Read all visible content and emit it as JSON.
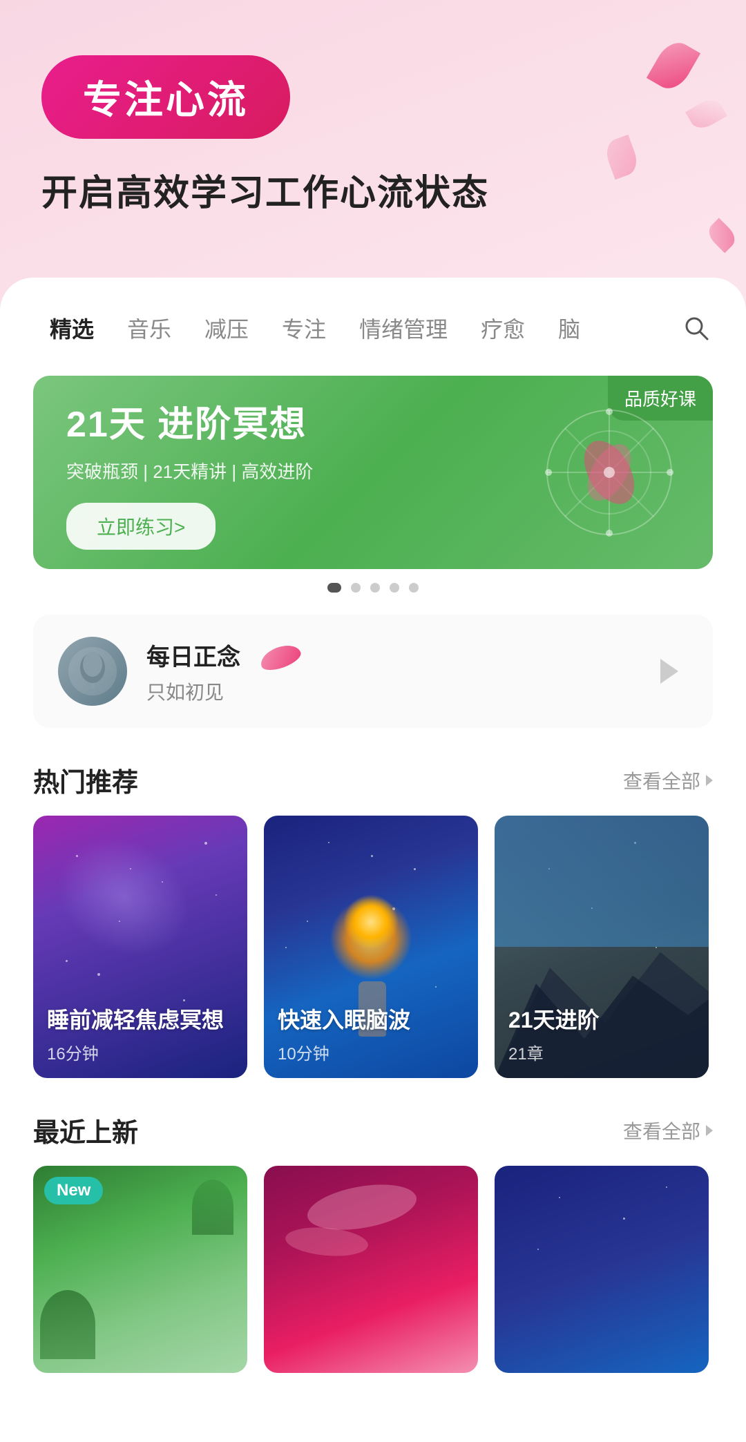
{
  "hero": {
    "badge_text": "专注心流",
    "subtitle": "开启高效学习工作心流状态"
  },
  "tabs": {
    "items": [
      {
        "label": "精选",
        "active": true
      },
      {
        "label": "音乐",
        "active": false
      },
      {
        "label": "减压",
        "active": false
      },
      {
        "label": "专注",
        "active": false
      },
      {
        "label": "情绪管理",
        "active": false
      },
      {
        "label": "疗愈",
        "active": false
      },
      {
        "label": "脑...",
        "active": false
      }
    ],
    "search_icon": "search-icon"
  },
  "banner": {
    "quality_tag": "品质好课",
    "title": "21天 进阶冥想",
    "desc": "突破瓶颈 | 21天精讲 | 高效进阶",
    "btn_text": "立即练习>",
    "dots_count": 5,
    "active_dot": 0
  },
  "daily": {
    "title": "每日正念",
    "subtitle": "只如初见",
    "play_icon": "play-icon"
  },
  "hot_section": {
    "title": "热门推荐",
    "more_text": "查看全部",
    "cards": [
      {
        "name": "睡前减轻焦虑冥想",
        "meta": "16分钟",
        "theme": "galaxy-purple"
      },
      {
        "name": "快速入眠脑波",
        "meta": "10分钟",
        "theme": "galaxy-blue"
      },
      {
        "name": "21天进阶...",
        "meta": "21章",
        "theme": "mountain-blue"
      }
    ]
  },
  "new_section": {
    "title": "最近上新",
    "more_text": "查看全部",
    "cards": [
      {
        "has_new_badge": true,
        "new_badge_text": "New",
        "theme": "green-nature"
      },
      {
        "has_new_badge": false,
        "theme": "pink-aurora"
      },
      {
        "has_new_badge": false,
        "theme": "dark-night"
      }
    ]
  }
}
